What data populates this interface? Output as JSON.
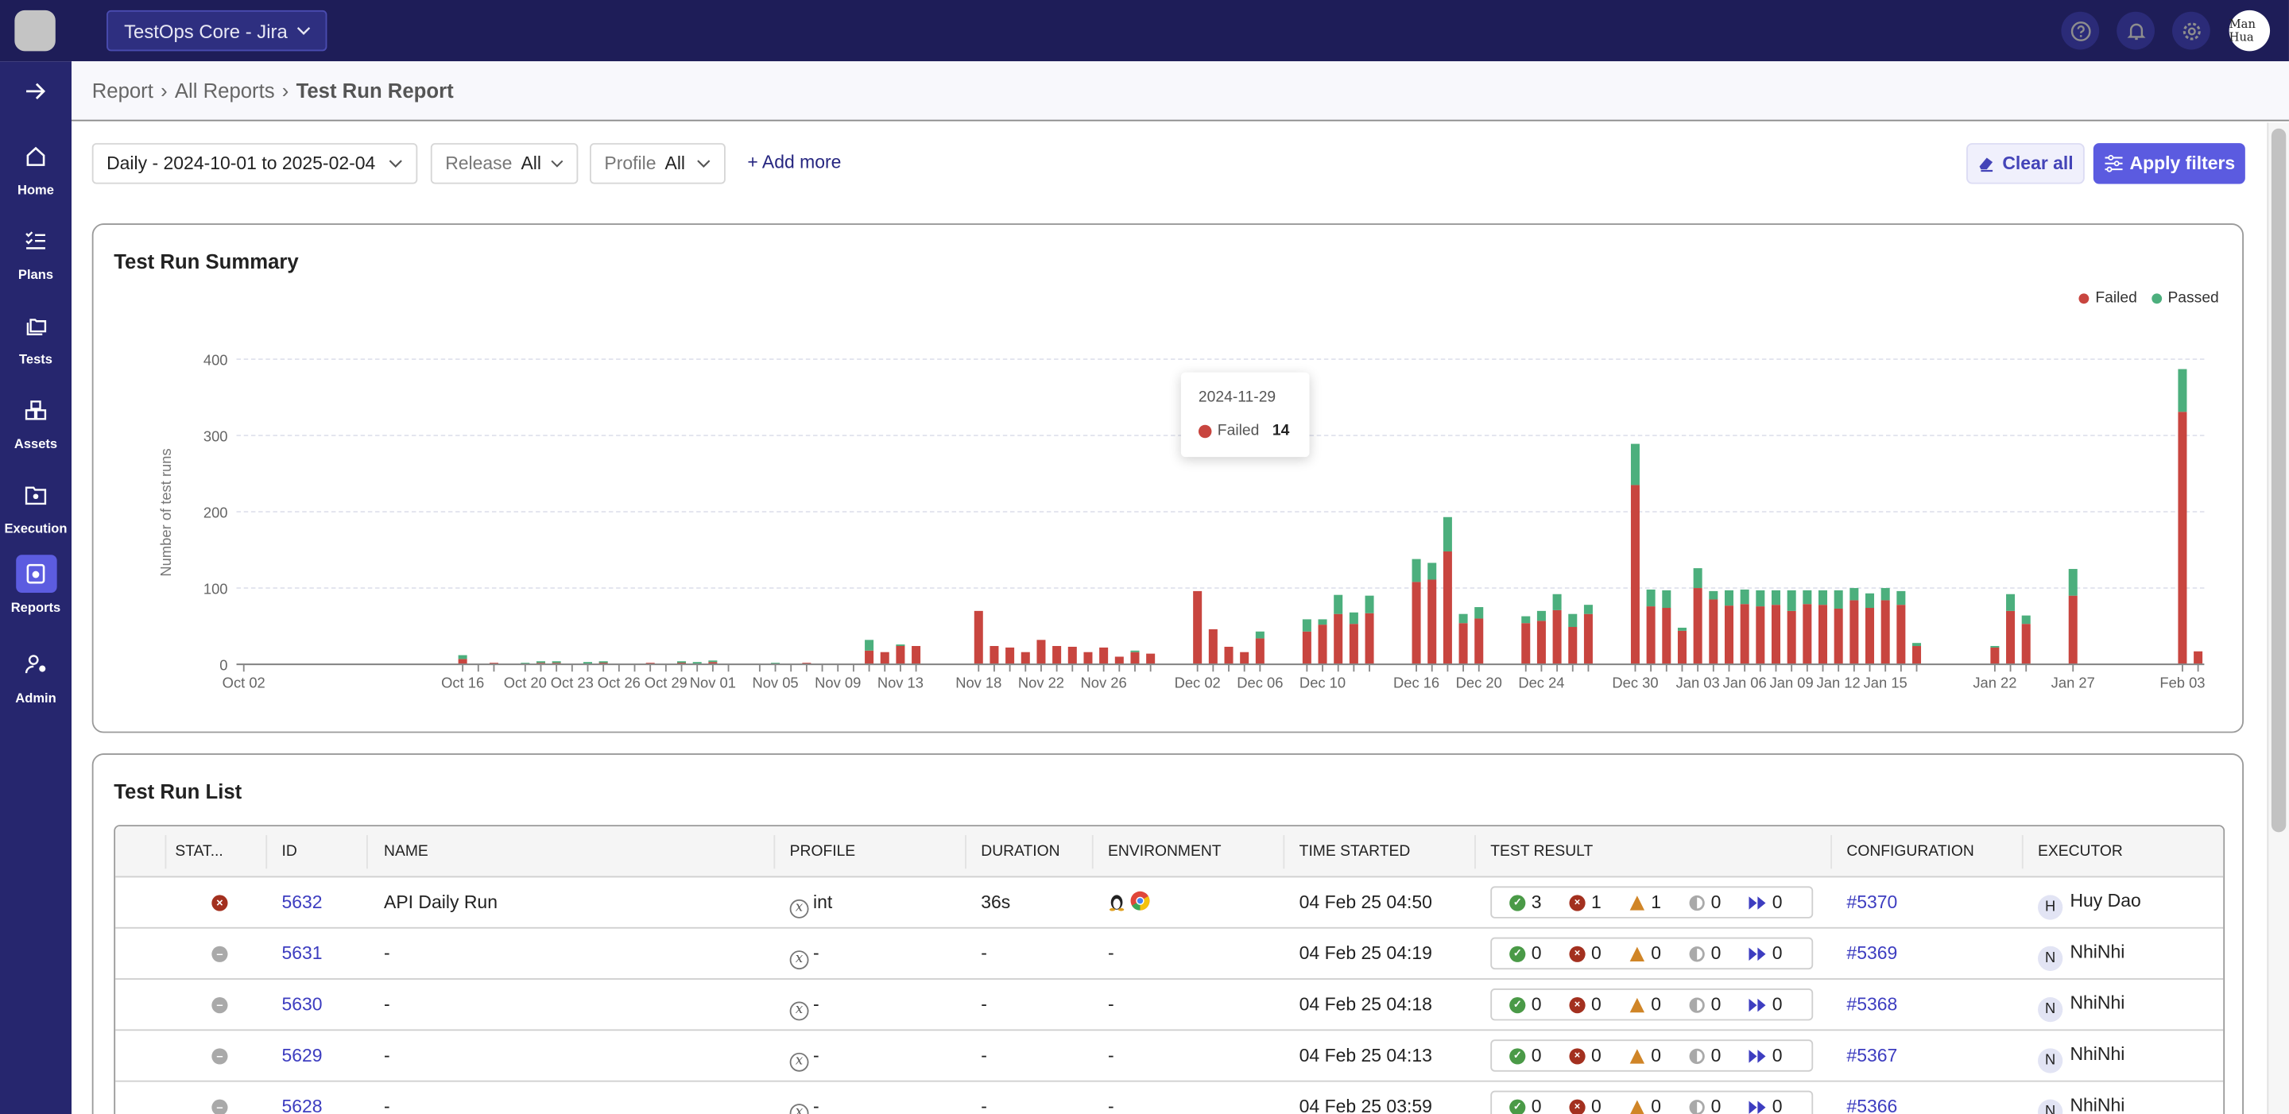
{
  "header": {
    "project_label": "TestOps Core - Jira",
    "icons": [
      "help-icon",
      "bell-icon",
      "gear-icon"
    ],
    "avatar_text": "Man Hua"
  },
  "sidebar": {
    "expand_icon": "arrow-right-icon",
    "items": [
      {
        "label": "Home",
        "icon": "home-icon"
      },
      {
        "label": "Plans",
        "icon": "checklist-icon"
      },
      {
        "label": "Tests",
        "icon": "folders-icon"
      },
      {
        "label": "Assets",
        "icon": "boxes-icon"
      },
      {
        "label": "Execution",
        "icon": "folder-gear-icon"
      },
      {
        "label": "Reports",
        "icon": "report-icon",
        "active": true
      },
      {
        "label": "Admin",
        "icon": "user-gear-icon"
      }
    ]
  },
  "breadcrumb": [
    "Report",
    "All Reports",
    "Test Run Report"
  ],
  "filters": {
    "date_range": "Daily - 2024-10-01 to 2025-02-04",
    "release_label": "Release",
    "release_value": "All",
    "profile_label": "Profile",
    "profile_value": "All",
    "add_more": "+ Add more",
    "clear_all": "Clear all",
    "apply": "Apply filters"
  },
  "summary": {
    "title": "Test Run Summary",
    "legend": [
      {
        "name": "Failed",
        "color": "#c8453f"
      },
      {
        "name": "Passed",
        "color": "#4caf7d"
      }
    ],
    "tooltip": {
      "date": "2024-11-29",
      "series": "Failed",
      "value": "14"
    }
  },
  "chart_data": {
    "type": "bar",
    "stacked": true,
    "ylabel": "Number of test runs",
    "ylim": [
      0,
      400
    ],
    "yticks": [
      0,
      100,
      200,
      300,
      400
    ],
    "grid": true,
    "legend_position": "top-right",
    "x_tick_labels": [
      "Oct 02",
      "Oct 16",
      "Oct 20",
      "Oct 23",
      "Oct 26",
      "Oct 29",
      "Nov 01",
      "Nov 05",
      "Nov 09",
      "Nov 13",
      "Nov 18",
      "Nov 22",
      "Nov 26",
      "Dec 02",
      "Dec 06",
      "Dec 10",
      "Dec 16",
      "Dec 20",
      "Dec 24",
      "Dec 30",
      "Jan 03",
      "Jan 06",
      "Jan 09",
      "Jan 12",
      "Jan 15",
      "Jan 22",
      "Jan 27",
      "Feb 03"
    ],
    "x": [
      "2024-10-02",
      "2024-10-16",
      "2024-10-17",
      "2024-10-18",
      "2024-10-20",
      "2024-10-21",
      "2024-10-22",
      "2024-10-23",
      "2024-10-24",
      "2024-10-25",
      "2024-10-26",
      "2024-10-27",
      "2024-10-28",
      "2024-10-29",
      "2024-10-30",
      "2024-10-31",
      "2024-11-01",
      "2024-11-02",
      "2024-11-04",
      "2024-11-05",
      "2024-11-06",
      "2024-11-07",
      "2024-11-08",
      "2024-11-09",
      "2024-11-10",
      "2024-11-11",
      "2024-11-12",
      "2024-11-13",
      "2024-11-14",
      "2024-11-18",
      "2024-11-19",
      "2024-11-20",
      "2024-11-21",
      "2024-11-22",
      "2024-11-23",
      "2024-11-24",
      "2024-11-25",
      "2024-11-26",
      "2024-11-27",
      "2024-11-28",
      "2024-11-29",
      "2024-12-02",
      "2024-12-03",
      "2024-12-04",
      "2024-12-05",
      "2024-12-06",
      "2024-12-09",
      "2024-12-10",
      "2024-12-11",
      "2024-12-12",
      "2024-12-13",
      "2024-12-16",
      "2024-12-17",
      "2024-12-18",
      "2024-12-19",
      "2024-12-20",
      "2024-12-23",
      "2024-12-24",
      "2024-12-25",
      "2024-12-26",
      "2024-12-27",
      "2024-12-30",
      "2024-12-31",
      "2025-01-01",
      "2025-01-02",
      "2025-01-03",
      "2025-01-04",
      "2025-01-05",
      "2025-01-06",
      "2025-01-07",
      "2025-01-08",
      "2025-01-09",
      "2025-01-10",
      "2025-01-11",
      "2025-01-12",
      "2025-01-13",
      "2025-01-14",
      "2025-01-15",
      "2025-01-16",
      "2025-01-17",
      "2025-01-22",
      "2025-01-23",
      "2025-01-24",
      "2025-01-27",
      "2025-02-03",
      "2025-02-04"
    ],
    "series": [
      {
        "name": "Failed",
        "color": "#c8453f",
        "values": [
          0,
          7,
          1,
          2,
          1,
          2,
          2,
          1,
          2,
          3,
          1,
          0,
          2,
          1,
          3,
          0,
          3,
          1,
          1,
          0,
          1,
          2,
          1,
          1,
          1,
          18,
          16,
          25,
          24,
          70,
          24,
          22,
          16,
          32,
          24,
          23,
          16,
          22,
          10,
          16,
          14,
          96,
          46,
          23,
          16,
          34,
          43,
          52,
          66,
          53,
          67,
          108,
          111,
          148,
          54,
          60,
          54,
          57,
          71,
          49,
          66,
          235,
          76,
          74,
          44,
          100,
          85,
          77,
          79,
          76,
          78,
          70,
          79,
          78,
          73,
          84,
          74,
          84,
          78,
          24,
          22,
          70,
          53,
          90,
          331,
          17
        ]
      },
      {
        "name": "Passed",
        "color": "#4caf7d",
        "values": [
          1,
          5,
          0,
          0,
          1,
          2,
          2,
          0,
          1,
          1,
          0,
          1,
          0,
          0,
          1,
          3,
          2,
          0,
          0,
          2,
          0,
          0,
          0,
          0,
          0,
          14,
          0,
          1,
          0,
          0,
          0,
          0,
          0,
          0,
          0,
          0,
          0,
          0,
          0,
          2,
          0,
          0,
          0,
          0,
          0,
          9,
          16,
          7,
          25,
          15,
          23,
          30,
          22,
          45,
          12,
          15,
          9,
          13,
          21,
          17,
          12,
          54,
          22,
          23,
          4,
          26,
          11,
          20,
          19,
          21,
          19,
          27,
          18,
          19,
          24,
          16,
          19,
          16,
          18,
          4,
          2,
          22,
          11,
          35,
          56,
          0
        ]
      }
    ]
  },
  "list": {
    "title": "Test Run List",
    "columns": [
      "STAT...",
      "ID",
      "NAME",
      "PROFILE",
      "DURATION",
      "ENVIRONMENT",
      "TIME STARTED",
      "TEST RESULT",
      "CONFIGURATION",
      "EXECUTOR"
    ],
    "result_icons": [
      "passed-icon",
      "failed-icon",
      "error-icon",
      "incomplete-icon",
      "skipped-icon"
    ],
    "rows": [
      {
        "status": "failed",
        "id": "5632",
        "name": "API Daily Run",
        "profile": "int",
        "duration": "36s",
        "environment": [
          "linux-icon",
          "chrome-icon"
        ],
        "time": "04 Feb 25 04:50",
        "results": [
          "3",
          "1",
          "1",
          "0",
          "0"
        ],
        "config": "#5370",
        "initial": "H",
        "executor": "Huy Dao"
      },
      {
        "status": "incomplete",
        "id": "5631",
        "name": "-",
        "profile": "-",
        "duration": "-",
        "env_text": "-",
        "time": "04 Feb 25 04:19",
        "results": [
          "0",
          "0",
          "0",
          "0",
          "0"
        ],
        "config": "#5369",
        "initial": "N",
        "executor": "NhiNhi"
      },
      {
        "status": "incomplete",
        "id": "5630",
        "name": "-",
        "profile": "-",
        "duration": "-",
        "env_text": "-",
        "time": "04 Feb 25 04:18",
        "results": [
          "0",
          "0",
          "0",
          "0",
          "0"
        ],
        "config": "#5368",
        "initial": "N",
        "executor": "NhiNhi"
      },
      {
        "status": "incomplete",
        "id": "5629",
        "name": "-",
        "profile": "-",
        "duration": "-",
        "env_text": "-",
        "time": "04 Feb 25 04:13",
        "results": [
          "0",
          "0",
          "0",
          "0",
          "0"
        ],
        "config": "#5367",
        "initial": "N",
        "executor": "NhiNhi"
      },
      {
        "status": "incomplete",
        "id": "5628",
        "name": "-",
        "profile": "-",
        "duration": "-",
        "env_text": "-",
        "time": "04 Feb 25 03:59",
        "results": [
          "0",
          "0",
          "0",
          "0",
          "0"
        ],
        "config": "#5366",
        "initial": "N",
        "executor": "NhiNhi"
      }
    ]
  }
}
